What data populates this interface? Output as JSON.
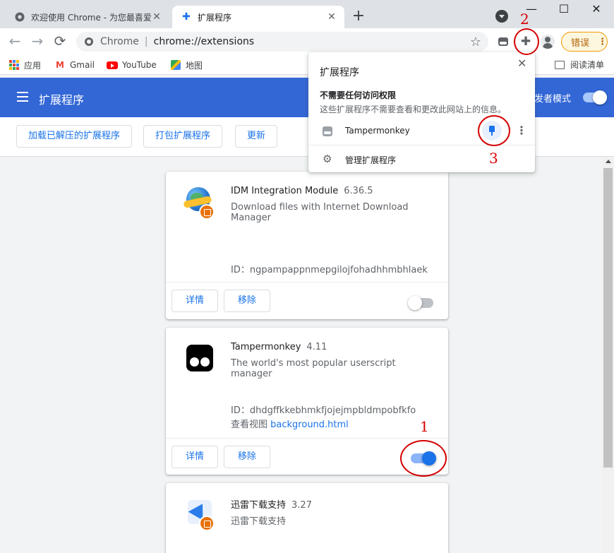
{
  "tabs": [
    {
      "title": "欢迎使用 Chrome - 为您最喜爱的",
      "active": false
    },
    {
      "title": "扩展程序",
      "active": true
    }
  ],
  "newtab_icon": "+",
  "window_controls": [
    "—",
    "☐",
    "✕"
  ],
  "toolbar": {
    "back_icon": "←",
    "forward_icon": "→",
    "reload_icon": "⟳",
    "omnibox_origin": "Chrome",
    "omnibox_url": "chrome://extensions",
    "star_icon": "☆",
    "error_label": "错误",
    "menu_dots": "⋮"
  },
  "bookmarks": [
    {
      "label": "应用",
      "icon": "apps-grid-icon"
    },
    {
      "label": "Gmail",
      "icon": "gmail-icon"
    },
    {
      "label": "YouTube",
      "icon": "youtube-icon"
    },
    {
      "label": "地图",
      "icon": "maps-icon"
    }
  ],
  "reading_list": "阅读清单",
  "header": {
    "title": "扩展程序",
    "dev_mode_label": "发者模式",
    "dev_mode_on": true
  },
  "dev_buttons": [
    "加载已解压的扩展程序",
    "打包扩展程序",
    "更新"
  ],
  "extensions": [
    {
      "name": "IDM Integration Module",
      "version": "6.36.5",
      "description": "Download files with Internet Download Manager",
      "id_line": "ID：ngpampappnmepgilojfohadhhmbhlaek",
      "details": "详情",
      "remove": "移除",
      "enabled": false
    },
    {
      "name": "Tampermonkey",
      "version": "4.11",
      "description": "The world's most popular userscript manager",
      "id_line": "ID：dhdgffkkebhmkfjojejmpbldmpobfkfo",
      "view_prefix": "查看视图",
      "view_link": "background.html",
      "details": "详情",
      "remove": "移除",
      "enabled": true
    },
    {
      "name": "迅雷下载支持",
      "version": "3.27",
      "description": "迅雷下载支持"
    }
  ],
  "popup": {
    "title": "扩展程序",
    "close_icon": "✕",
    "section_title": "不需要任何访问权限",
    "section_desc": "这些扩展程序不需要查看和更改此网站上的信息。",
    "item_name": "Tampermonkey",
    "item_more": "⋮",
    "manage_label": "管理扩展程序",
    "manage_icon": "⚙"
  },
  "annotations": [
    "1",
    "2",
    "3"
  ],
  "colors": {
    "header_blue": "#3367d6",
    "link_blue": "#1a73e8",
    "annotation_red": "#d50000",
    "error_orange": "#f29900"
  }
}
